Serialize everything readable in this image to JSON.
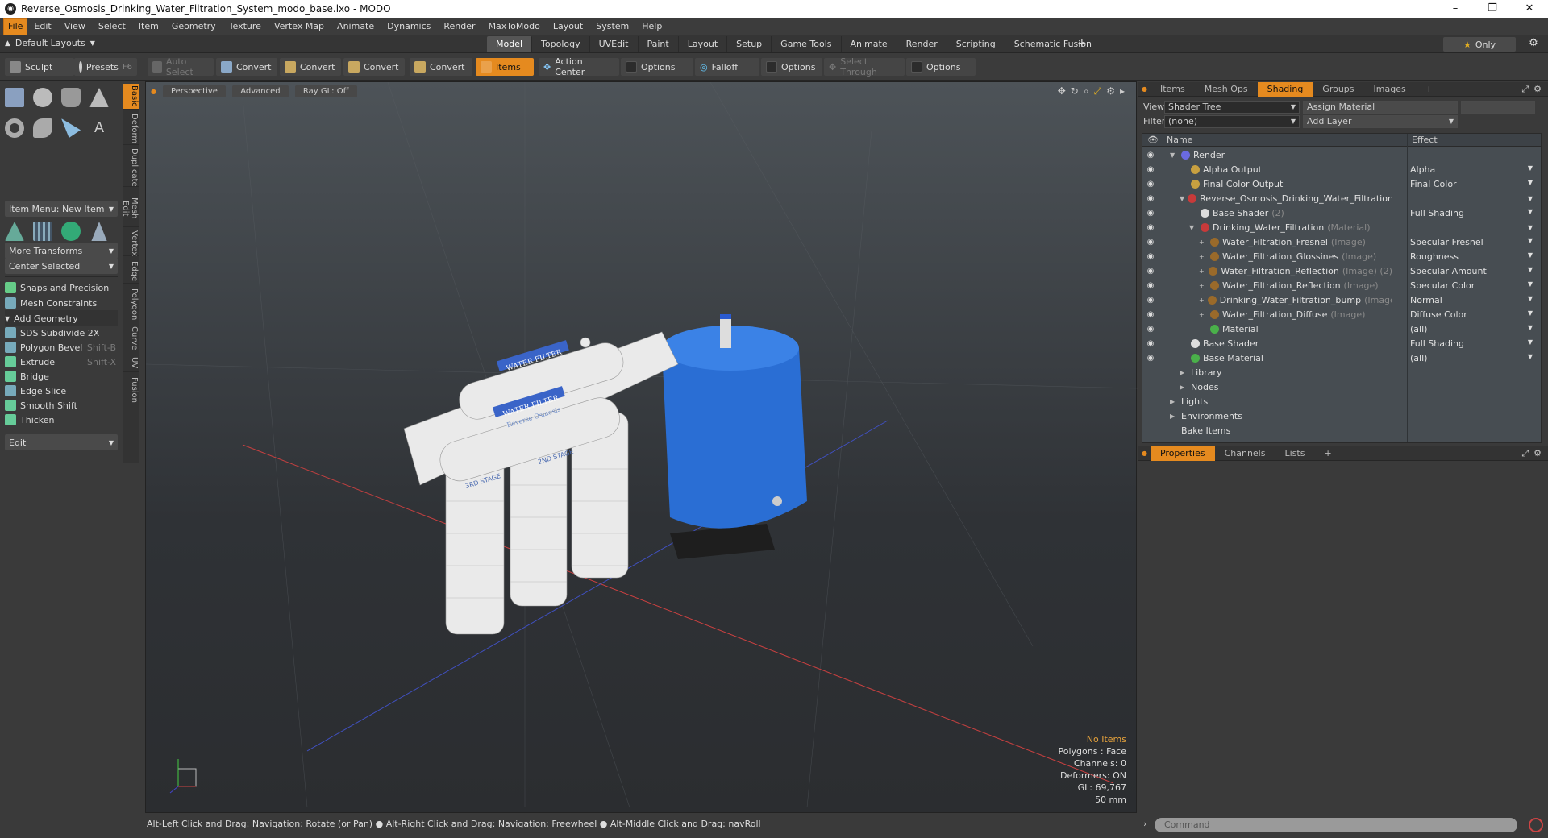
{
  "window": {
    "title": "Reverse_Osmosis_Drinking_Water_Filtration_System_modo_base.lxo - MODO",
    "controls": [
      "–",
      "❐",
      "✕"
    ]
  },
  "menu": [
    "File",
    "Edit",
    "View",
    "Select",
    "Item",
    "Geometry",
    "Texture",
    "Vertex Map",
    "Animate",
    "Dynamics",
    "Render",
    "MaxToModo",
    "Layout",
    "System",
    "Help"
  ],
  "layout_selector": "Default Layouts",
  "mode_tabs": [
    "Model",
    "Topology",
    "UVEdit",
    "Paint",
    "Layout",
    "Setup",
    "Game Tools",
    "Animate",
    "Render",
    "Scripting",
    "Schematic Fusion"
  ],
  "plus": "+",
  "only_label": "Only",
  "toolbar": {
    "sculpt": "Sculpt",
    "presets": "Presets",
    "presets_key": "F6",
    "auto_select": "Auto Select",
    "convert": "Convert",
    "items": "Items",
    "action_center": "Action Center",
    "options": "Options",
    "falloff": "Falloff",
    "select_through": "Select Through"
  },
  "left": {
    "item_menu": "Item Menu: New Item",
    "more_transforms": "More Transforms",
    "center_selected": "Center Selected",
    "snaps": "Snaps and Precision",
    "mesh_constraints": "Mesh Constraints",
    "add_geometry": "Add Geometry",
    "tools": [
      {
        "label": "SDS Subdivide 2X",
        "key": ""
      },
      {
        "label": "Polygon Bevel",
        "key": "Shift-B"
      },
      {
        "label": "Extrude",
        "key": "Shift-X"
      },
      {
        "label": "Bridge",
        "key": ""
      },
      {
        "label": "Edge Slice",
        "key": ""
      },
      {
        "label": "Smooth Shift",
        "key": ""
      },
      {
        "label": "Thicken",
        "key": ""
      }
    ],
    "edit": "Edit",
    "side_tabs": [
      "Basic",
      "Deform",
      "Duplicate",
      "Mesh Edit",
      "Vertex",
      "Edge",
      "Polygon",
      "Curve",
      "UV",
      "Fusion"
    ]
  },
  "viewport": {
    "perspective": "Perspective",
    "advanced": "Advanced",
    "raygl": "Ray GL: Off",
    "stats": {
      "items": "No Items",
      "polygons": "Polygons : Face",
      "channels": "Channels: 0",
      "deformers": "Deformers: ON",
      "gl": "GL: 69,767",
      "scale": "50 mm"
    },
    "model_labels": {
      "water_filter": "WATER FILTER",
      "reverse_osmosis": "Reverse Osmosis",
      "stage3": "3RD STAGE",
      "stage2": "2ND STAGE"
    }
  },
  "status": "Alt-Left Click and Drag: Navigation: Rotate (or Pan) ● Alt-Right Click and Drag: Navigation: Freewheel ● Alt-Middle Click and Drag: navRoll",
  "right": {
    "tabs": [
      "Items",
      "Mesh Ops",
      "Shading",
      "Groups",
      "Images"
    ],
    "view_label": "View",
    "view_value": "Shader Tree",
    "assign_material": "Assign Material",
    "filter_label": "Filter",
    "filter_value": "(none)",
    "add_layer": "Add Layer",
    "col_name": "Name",
    "col_effect": "Effect",
    "tree": [
      {
        "name": "Render",
        "sub": "",
        "effect": "",
        "indent": 0,
        "color": "#6a6ae0"
      },
      {
        "name": "Alpha Output",
        "sub": "",
        "effect": "Alpha",
        "indent": 1,
        "color": "#c8a040"
      },
      {
        "name": "Final Color Output",
        "sub": "",
        "effect": "Final Color",
        "indent": 1,
        "color": "#c8a040"
      },
      {
        "name": "Reverse_Osmosis_Drinking_Water_Filtration_Sys...",
        "sub": "",
        "effect": "",
        "indent": 1,
        "color": "#c83a3a"
      },
      {
        "name": "Base Shader",
        "sub": "(2)",
        "effect": "Full Shading",
        "indent": 2,
        "color": "#dddddd"
      },
      {
        "name": "Drinking_Water_Filtration",
        "sub": "(Material)",
        "effect": "",
        "indent": 2,
        "color": "#c83a3a"
      },
      {
        "name": "Water_Filtration_Fresnel",
        "sub": "(Image)",
        "effect": "Specular Fresnel",
        "indent": 3,
        "color": "#9a6a2a"
      },
      {
        "name": "Water_Filtration_Glossines",
        "sub": "(Image)",
        "effect": "Roughness",
        "indent": 3,
        "color": "#9a6a2a"
      },
      {
        "name": "Water_Filtration_Reflection",
        "sub": "(Image) (2)",
        "effect": "Specular Amount",
        "indent": 3,
        "color": "#9a6a2a"
      },
      {
        "name": "Water_Filtration_Reflection",
        "sub": "(Image)",
        "effect": "Specular Color",
        "indent": 3,
        "color": "#9a6a2a"
      },
      {
        "name": "Drinking_Water_Filtration_bump",
        "sub": "(Image)",
        "effect": "Normal",
        "indent": 3,
        "color": "#9a6a2a"
      },
      {
        "name": "Water_Filtration_Diffuse",
        "sub": "(Image)",
        "effect": "Diffuse Color",
        "indent": 3,
        "color": "#9a6a2a"
      },
      {
        "name": "Material",
        "sub": "",
        "effect": "(all)",
        "indent": 3,
        "color": "#4ab04a"
      },
      {
        "name": "Base Shader",
        "sub": "",
        "effect": "Full Shading",
        "indent": 1,
        "color": "#dddddd"
      },
      {
        "name": "Base Material",
        "sub": "",
        "effect": "(all)",
        "indent": 1,
        "color": "#4ab04a"
      },
      {
        "name": "Library",
        "sub": "",
        "effect": "",
        "indent": 1,
        "color": ""
      },
      {
        "name": "Nodes",
        "sub": "",
        "effect": "",
        "indent": 1,
        "color": ""
      },
      {
        "name": "Lights",
        "sub": "",
        "effect": "",
        "indent": 0,
        "color": ""
      },
      {
        "name": "Environments",
        "sub": "",
        "effect": "",
        "indent": 0,
        "color": ""
      },
      {
        "name": "Bake Items",
        "sub": "",
        "effect": "",
        "indent": 0,
        "color": ""
      }
    ],
    "lower_tabs": [
      "Properties",
      "Channels",
      "Lists"
    ],
    "command_placeholder": "Command"
  },
  "colors": {
    "accent": "#e58a1f",
    "tank": "#2a6ed4"
  }
}
